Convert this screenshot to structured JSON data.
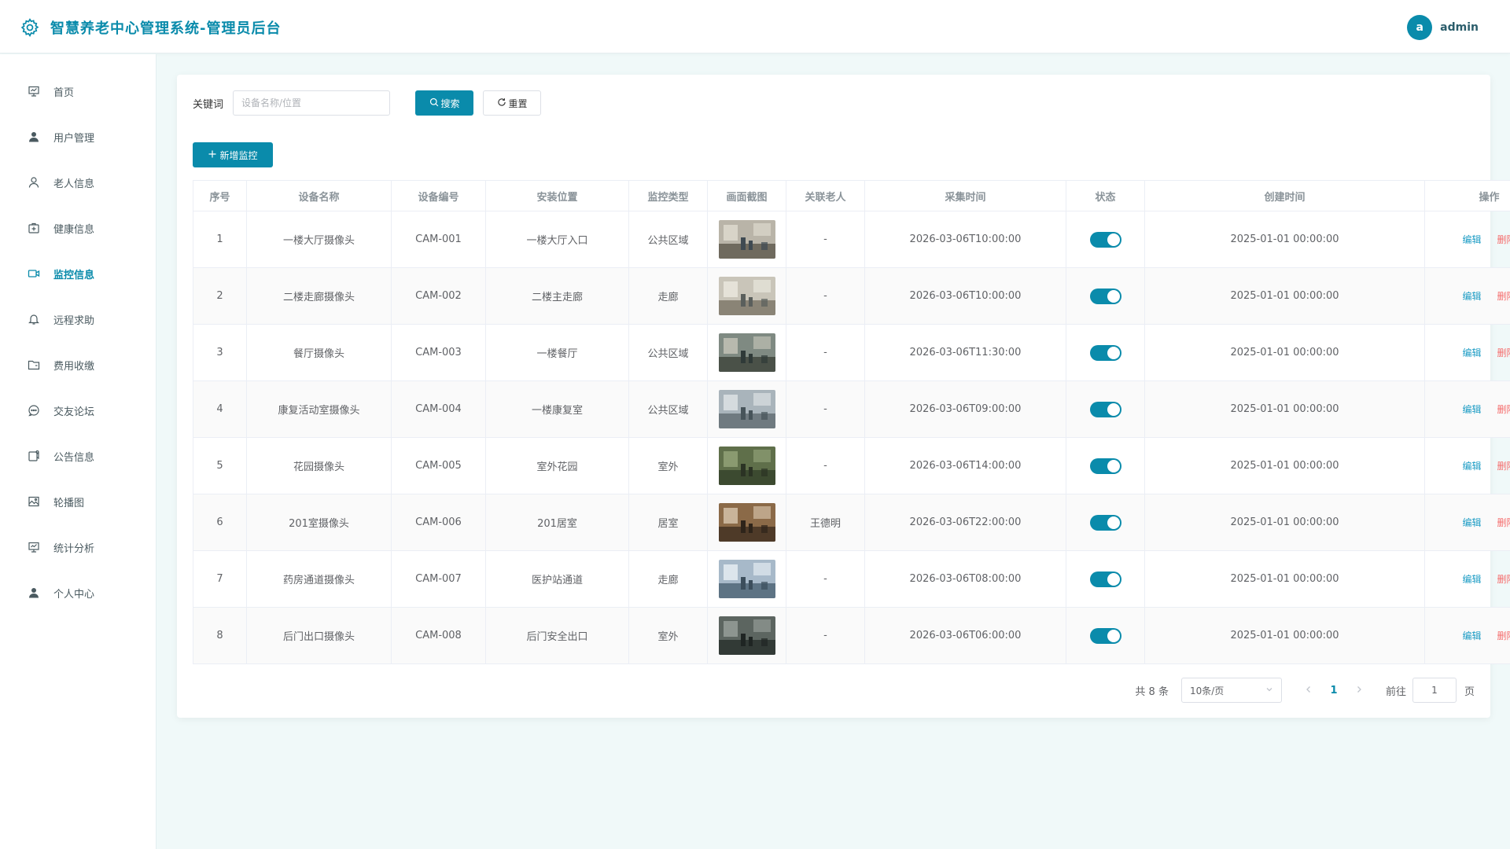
{
  "header": {
    "title": "智慧养老中心管理系统-管理员后台",
    "avatar_letter": "a",
    "username": "admin"
  },
  "sidebar": {
    "items": [
      {
        "label": "首页",
        "icon": "monitor-chart-icon"
      },
      {
        "label": "用户管理",
        "icon": "user-icon"
      },
      {
        "label": "老人信息",
        "icon": "user-outline-icon"
      },
      {
        "label": "健康信息",
        "icon": "first-aid-kit-icon"
      },
      {
        "label": "监控信息",
        "icon": "video-camera-icon",
        "active": true
      },
      {
        "label": "远程求助",
        "icon": "bell-icon"
      },
      {
        "label": "费用收缴",
        "icon": "folder-icon"
      },
      {
        "label": "交友论坛",
        "icon": "chat-bubble-icon"
      },
      {
        "label": "公告信息",
        "icon": "notice-icon"
      },
      {
        "label": "轮播图",
        "icon": "picture-icon"
      },
      {
        "label": "统计分析",
        "icon": "monitor-chart-icon"
      },
      {
        "label": "个人中心",
        "icon": "user-icon"
      }
    ]
  },
  "search": {
    "label": "关键词",
    "placeholder": "设备名称/位置",
    "search_btn": "搜索",
    "reset_btn": "重置"
  },
  "add_btn": "新增监控",
  "table": {
    "headers": [
      "序号",
      "设备名称",
      "设备编号",
      "安装位置",
      "监控类型",
      "画面截图",
      "关联老人",
      "采集时间",
      "状态",
      "创建时间",
      "操作"
    ],
    "rows": [
      {
        "no": "1",
        "name": "一楼大厅摄像头",
        "code": "CAM-001",
        "location": "一楼大厅入口",
        "type": "公共区域",
        "elder": "-",
        "collect": "2026-03-06T10:00:00",
        "status": true,
        "created": "2025-01-01 00:00:00"
      },
      {
        "no": "2",
        "name": "二楼走廊摄像头",
        "code": "CAM-002",
        "location": "二楼主走廊",
        "type": "走廊",
        "elder": "-",
        "collect": "2026-03-06T10:00:00",
        "status": true,
        "created": "2025-01-01 00:00:00"
      },
      {
        "no": "3",
        "name": "餐厅摄像头",
        "code": "CAM-003",
        "location": "一楼餐厅",
        "type": "公共区域",
        "elder": "-",
        "collect": "2026-03-06T11:30:00",
        "status": true,
        "created": "2025-01-01 00:00:00"
      },
      {
        "no": "4",
        "name": "康复活动室摄像头",
        "code": "CAM-004",
        "location": "一楼康复室",
        "type": "公共区域",
        "elder": "-",
        "collect": "2026-03-06T09:00:00",
        "status": true,
        "created": "2025-01-01 00:00:00"
      },
      {
        "no": "5",
        "name": "花园摄像头",
        "code": "CAM-005",
        "location": "室外花园",
        "type": "室外",
        "elder": "-",
        "collect": "2026-03-06T14:00:00",
        "status": true,
        "created": "2025-01-01 00:00:00"
      },
      {
        "no": "6",
        "name": "201室摄像头",
        "code": "CAM-006",
        "location": "201居室",
        "type": "居室",
        "elder": "王德明",
        "collect": "2026-03-06T22:00:00",
        "status": true,
        "created": "2025-01-01 00:00:00"
      },
      {
        "no": "7",
        "name": "药房通道摄像头",
        "code": "CAM-007",
        "location": "医护站通道",
        "type": "走廊",
        "elder": "-",
        "collect": "2026-03-06T08:00:00",
        "status": true,
        "created": "2025-01-01 00:00:00"
      },
      {
        "no": "8",
        "name": "后门出口摄像头",
        "code": "CAM-008",
        "location": "后门安全出口",
        "type": "室外",
        "elder": "-",
        "collect": "2026-03-06T06:00:00",
        "status": true,
        "created": "2025-01-01 00:00:00"
      }
    ],
    "edit_label": "编辑",
    "delete_label": "删除"
  },
  "pager": {
    "total": "共 8 条",
    "page_size": "10条/页",
    "current": "1",
    "goto_label": "前往",
    "goto_value": "1",
    "page_unit": "页"
  },
  "colors": {
    "accent": "#0a8bab",
    "danger": "#f56c6c",
    "link": "#1a9bc4"
  }
}
